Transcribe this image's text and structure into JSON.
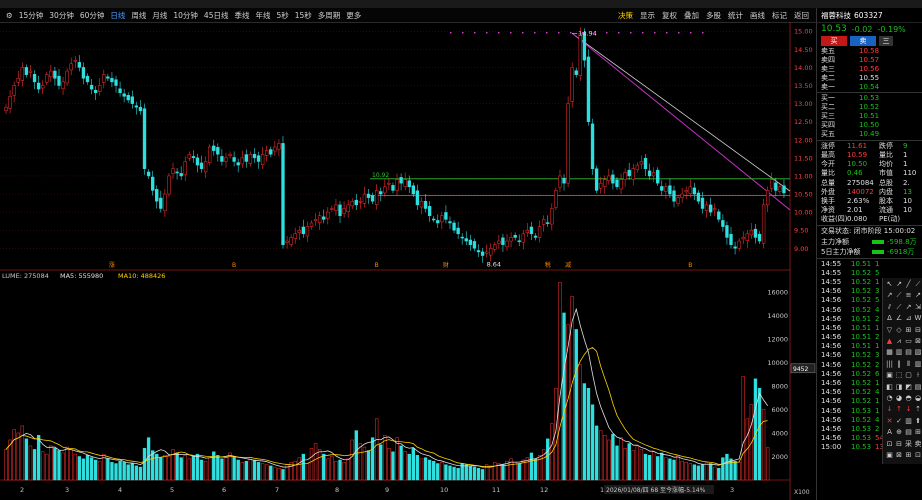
{
  "toolbar": {
    "timeframes": [
      "15分钟",
      "30分钟",
      "60分钟",
      "日线",
      "周线",
      "月线",
      "10分钟",
      "45日线",
      "季线",
      "年线",
      "5秒",
      "15秒",
      "多周期",
      "更多"
    ],
    "active_index": 3,
    "tools": [
      "决策",
      "显示",
      "复权",
      "叠加",
      "多股",
      "统计",
      "画线",
      "标记",
      "返回"
    ]
  },
  "stock": {
    "name": "福蓉科技",
    "code": "603327",
    "price": "10.53",
    "change": "-0.02",
    "change_pct": "-0.19%"
  },
  "buttons": {
    "buy": "买",
    "sell": "卖",
    "extra": "三"
  },
  "asks": [
    {
      "label": "卖五",
      "price": "10.58",
      "vol": "",
      "color": "#ff3b3b"
    },
    {
      "label": "卖四",
      "price": "10.57",
      "vol": "",
      "color": "#ff3b3b"
    },
    {
      "label": "卖三",
      "price": "10.56",
      "vol": "",
      "color": "#ff3b3b"
    },
    {
      "label": "卖二",
      "price": "10.55",
      "vol": "",
      "color": "#e0e0e0"
    },
    {
      "label": "卖一",
      "price": "10.54",
      "vol": "",
      "color": "#19c219"
    }
  ],
  "bids": [
    {
      "label": "买一",
      "price": "10.53",
      "vol": "",
      "color": "#19c219"
    },
    {
      "label": "买二",
      "price": "10.52",
      "vol": "",
      "color": "#19c219"
    },
    {
      "label": "买三",
      "price": "10.51",
      "vol": "",
      "color": "#19c219"
    },
    {
      "label": "买四",
      "price": "10.50",
      "vol": "",
      "color": "#19c219"
    },
    {
      "label": "买五",
      "price": "10.49",
      "vol": "",
      "color": "#19c219"
    }
  ],
  "stats": [
    {
      "l1": "涨停",
      "v1": "11.61",
      "c1": "#ff3b3b",
      "l2": "跌停",
      "v2": "9",
      "c2": "#19c219"
    },
    {
      "l1": "最高",
      "v1": "10.59",
      "c1": "#ff3b3b",
      "l2": "量比",
      "v2": "1",
      "c2": "#e0e0e0"
    },
    {
      "l1": "今开",
      "v1": "10.50",
      "c1": "#19c219",
      "l2": "均价",
      "v2": "1",
      "c2": "#e0e0e0"
    },
    {
      "l1": "量比",
      "v1": "0.46",
      "c1": "#19c219",
      "l2": "市值",
      "v2": "110",
      "c2": "#e0e0e0"
    },
    {
      "l1": "总量",
      "v1": "275084",
      "c1": "#e0e0e0",
      "l2": "总股",
      "v2": "2.",
      "c2": "#e0e0e0"
    },
    {
      "l1": "外盘",
      "v1": "140072",
      "c1": "#ff3b3b",
      "l2": "内盘",
      "v2": "13",
      "c2": "#19c219"
    },
    {
      "l1": "换手",
      "v1": "2.63%",
      "c1": "#e0e0e0",
      "l2": "股本",
      "v2": "10",
      "c2": "#e0e0e0"
    },
    {
      "l1": "净资",
      "v1": "2.01",
      "c1": "#e0e0e0",
      "l2": "流通",
      "v2": "10",
      "c2": "#e0e0e0"
    },
    {
      "l1": "收益(四)",
      "v1": "0.080",
      "c1": "#e0e0e0",
      "l2": "PE(动)",
      "v2": "",
      "c2": "#e0e0e0"
    }
  ],
  "trade_status": "交易状态: 闭市阶段 15:00:02",
  "flows": [
    {
      "label": "主力净额",
      "value": "-598.8万"
    },
    {
      "label": "5日主力净额",
      "value": "-6918万"
    }
  ],
  "ticks": [
    {
      "t": "14:55",
      "p": "10.51",
      "v": "1"
    },
    {
      "t": "14:55",
      "p": "10.52",
      "v": "5"
    },
    {
      "t": "14:55",
      "p": "10.52",
      "v": "1"
    },
    {
      "t": "14:56",
      "p": "10.52",
      "v": "3"
    },
    {
      "t": "14:56",
      "p": "10.52",
      "v": "5"
    },
    {
      "t": "14:56",
      "p": "10.52",
      "v": "4"
    },
    {
      "t": "14:56",
      "p": "10.51",
      "v": "2"
    },
    {
      "t": "14:56",
      "p": "10.51",
      "v": "1"
    },
    {
      "t": "14:56",
      "p": "10.51",
      "v": "2"
    },
    {
      "t": "14:56",
      "p": "10.51",
      "v": "1"
    },
    {
      "t": "14:56",
      "p": "10.52",
      "v": "3"
    },
    {
      "t": "14:56",
      "p": "10.52",
      "v": "2"
    },
    {
      "t": "14:56",
      "p": "10.52",
      "v": "6"
    },
    {
      "t": "14:56",
      "p": "10.52",
      "v": "1"
    },
    {
      "t": "14:56",
      "p": "10.52",
      "v": "4"
    },
    {
      "t": "14:56",
      "p": "10.52",
      "v": "1"
    },
    {
      "t": "14:56",
      "p": "10.53",
      "v": "1"
    },
    {
      "t": "14:56",
      "p": "10.52",
      "v": "4"
    },
    {
      "t": "14:56",
      "p": "10.53",
      "v": "2"
    },
    {
      "t": "14:56",
      "p": "10.53",
      "v": "54"
    },
    {
      "t": "15:00",
      "p": "10.53",
      "v": "131"
    }
  ],
  "draw_tools": [
    "↖",
    "↗",
    "╱",
    "⟋",
    "↗",
    "⟋",
    "≡",
    "↗",
    "⫽",
    "⟋",
    "↗",
    "⇲",
    "Δ",
    "∠",
    "⊿",
    "W",
    "▽",
    "◇",
    "⊞",
    "⊟",
    "▲",
    "⩘",
    "▭",
    "⊠",
    "▦",
    "▥",
    "▤",
    "▧",
    "|||",
    "‖",
    "⦀",
    "▥",
    "▣",
    "⬚",
    "▢",
    "⟊",
    "◧",
    "◨",
    "◩",
    "▤",
    "◔",
    "◕",
    "◓",
    "◒",
    "↓",
    "↑",
    "↓",
    "⇡",
    "✕",
    "✓",
    "▥",
    "⬆",
    "A",
    "⊕",
    "▤",
    "⊞",
    "⊡",
    "⊟",
    "采",
    "卖",
    "▣",
    "⊠",
    "⊞",
    "⊡"
  ],
  "chart": {
    "price_axis": [
      "15.00",
      "14.50",
      "14.00",
      "13.50",
      "13.00",
      "12.50",
      "12.00",
      "11.50",
      "11.00",
      "10.50",
      "10.00",
      "9.50",
      "9.00"
    ],
    "high_label": "14.94",
    "low_label": "8.64",
    "level_1": "10.92",
    "volume_header": {
      "text": "LUME: 275084",
      "ma5": "MA5: 555980",
      "ma10": "MA10: 488426"
    },
    "vol_axis": [
      "16000",
      "14000",
      "12000",
      "10000",
      "8000",
      "6000",
      "4000",
      "2000"
    ],
    "vol_unit": "X100",
    "cross_value": "9452",
    "x_labels": [
      "2",
      "3",
      "4",
      "5",
      "6",
      "7",
      "8",
      "9",
      "10",
      "11",
      "12",
      "1",
      "2",
      "3"
    ],
    "x_right": "日线",
    "date_note": "2026/01/08/四 68 至今涨幅-5.14%",
    "markers": [
      "涨",
      "B",
      "B",
      "财",
      "税",
      "减",
      "B"
    ]
  },
  "chart_data": {
    "type": "candlestick",
    "title": "",
    "ylim": [
      8.4,
      15.2
    ],
    "closes": [
      12.9,
      13.2,
      13.5,
      13.7,
      14.0,
      13.8,
      13.9,
      13.6,
      13.4,
      13.5,
      13.8,
      13.9,
      13.7,
      13.5,
      13.6,
      13.9,
      14.1,
      14.2,
      14.0,
      13.7,
      13.6,
      13.4,
      13.3,
      13.5,
      13.8,
      13.7,
      13.6,
      13.5,
      13.3,
      13.2,
      13.1,
      13.0,
      12.9,
      12.8,
      11.2,
      11.0,
      10.6,
      10.3,
      10.1,
      10.5,
      11.0,
      11.2,
      11.1,
      11.0,
      11.4,
      11.6,
      11.5,
      11.3,
      11.2,
      11.4,
      11.8,
      11.7,
      11.6,
      11.4,
      11.5,
      11.6,
      11.4,
      11.3,
      11.5,
      11.4,
      11.6,
      11.5,
      11.4,
      11.6,
      11.7,
      11.6,
      11.8,
      11.9,
      9.1,
      9.2,
      9.3,
      9.4,
      9.5,
      9.4,
      9.6,
      9.7,
      9.8,
      9.9,
      9.8,
      10.0,
      10.1,
      10.2,
      9.9,
      10.1,
      10.2,
      10.3,
      10.2,
      10.3,
      10.5,
      10.4,
      10.3,
      10.6,
      10.5,
      10.7,
      10.8,
      10.6,
      10.9,
      10.8,
      10.9,
      10.7,
      10.5,
      10.2,
      10.3,
      10.1,
      9.9,
      9.8,
      9.7,
      9.9,
      9.8,
      9.7,
      9.5,
      9.4,
      9.3,
      9.2,
      9.1,
      9.0,
      8.9,
      8.8,
      8.9,
      9.0,
      9.1,
      9.2,
      9.1,
      9.2,
      9.3,
      9.3,
      9.2,
      9.4,
      9.5,
      9.4,
      9.3,
      9.6,
      9.8,
      9.7,
      10.1,
      10.6,
      11.0,
      10.8,
      13.0,
      14.0,
      13.8,
      14.94,
      14.2,
      12.5,
      11.2,
      10.6,
      10.8,
      10.9,
      11.0,
      10.8,
      10.7,
      10.9,
      11.1,
      11.0,
      11.2,
      11.3,
      11.4,
      11.2,
      11.0,
      11.1,
      10.8,
      10.6,
      10.7,
      10.5,
      10.3,
      10.4,
      10.5,
      10.6,
      10.7,
      10.5,
      10.3,
      10.1,
      10.2,
      10.0,
      10.1,
      9.8,
      9.6,
      9.3,
      9.1,
      9.0,
      9.2,
      9.3,
      9.4,
      9.5,
      9.3,
      9.2,
      10.2,
      10.6,
      10.9,
      10.6,
      10.7,
      10.53
    ],
    "volume": [
      2600,
      3400,
      4300,
      4000,
      4600,
      3500,
      2900,
      2600,
      3800,
      2400,
      2200,
      2900,
      2700,
      2500,
      2300,
      2800,
      2600,
      2200,
      2000,
      1800,
      2100,
      1900,
      1700,
      1600,
      2200,
      1800,
      1500,
      1400,
      1600,
      1500,
      1300,
      1400,
      1200,
      1100,
      2700,
      3600,
      2500,
      2200,
      1900,
      2100,
      2000,
      2600,
      2300,
      1900,
      2100,
      1800,
      2000,
      2200,
      1700,
      1600,
      1900,
      2400,
      2100,
      1800,
      1900,
      2300,
      2000,
      1700,
      1500,
      1600,
      1900,
      1700,
      1500,
      1400,
      1300,
      1200,
      1100,
      1000,
      900,
      1300,
      1500,
      1600,
      1900,
      2200,
      1400,
      2700,
      3100,
      2600,
      2200,
      1800,
      2000,
      1600,
      1700,
      1500,
      1800,
      3400,
      4200,
      3100,
      2800,
      2500,
      3600,
      5200,
      3000,
      3800,
      2700,
      2400,
      3600,
      2900,
      2400,
      2200,
      2700,
      2100,
      1800,
      1900,
      1700,
      1600,
      1400,
      1500,
      1300,
      1200,
      1100,
      1000,
      1400,
      1300,
      1200,
      1100,
      1000,
      900,
      1300,
      1200,
      1500,
      1400,
      1300,
      1600,
      1800,
      1500,
      1400,
      1700,
      1900,
      2300,
      1800,
      2100,
      2600,
      3500,
      4800,
      7800,
      16800,
      14200,
      13200,
      15600,
      12800,
      9800,
      8200,
      7800,
      6400,
      4600,
      4200,
      3800,
      3400,
      3900,
      2900,
      3600,
      2700,
      3100,
      2500,
      2900,
      2600,
      2200,
      2100,
      2400,
      2000,
      2300,
      1900,
      1800,
      1700,
      2100,
      1600,
      1500,
      1400,
      1300,
      1200,
      1300,
      1500,
      1400,
      1100,
      1000,
      1900,
      2200,
      1800,
      1600,
      1500,
      8800,
      5200,
      6400,
      8600,
      7800,
      6000,
      2750
    ]
  }
}
